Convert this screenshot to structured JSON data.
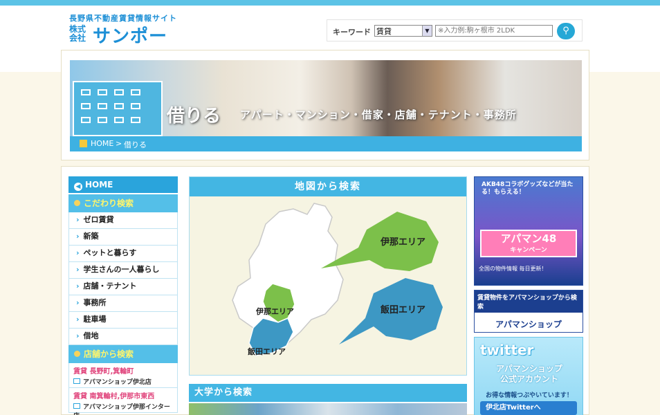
{
  "header": {
    "brand_sub": "長野県不動産賃貸情報サイト",
    "brand_co": "株式会社",
    "brand_name": "サンポー"
  },
  "search": {
    "label": "キーワード",
    "select_value": "賃貸",
    "placeholder": "※入力例:駒ヶ根市 2LDK",
    "button_icon": "search-icon"
  },
  "hero": {
    "title": "借りる",
    "subtitle": "アパート・マンション・借家・店舗・テナント・事務所"
  },
  "breadcrumb": {
    "home": "HOME",
    "separator": ">",
    "current": "借りる"
  },
  "sidebar": {
    "home": "HOME",
    "section1": "こだわり検索",
    "items": [
      "ゼロ賃貸",
      "新築",
      "ペットと暮らす",
      "学生さんの一人暮らし",
      "店舗・テナント",
      "事務所",
      "駐車場",
      "借地"
    ],
    "section2": "店舗から検索",
    "shops": [
      {
        "area": "賃貸 長野町,箕輪町",
        "name": "アパマンショップ伊北店"
      },
      {
        "area": "賃貸 南箕輪村,伊那市東西",
        "name": "アパマンショップ伊那インター店"
      }
    ]
  },
  "map": {
    "title": "地図から検索",
    "ina_label": "伊那エリア",
    "iida_label": "飯田エリア",
    "ina_bubble": "伊那エリア",
    "iida_bubble": "飯田エリア"
  },
  "university": {
    "title": "大学から検索"
  },
  "banners": {
    "akb_top": "AKB48コラボグッズなどが当たる！もらえる！",
    "akb_main": "アパマン48",
    "akb_campaign": "キャンペーン",
    "akb_foot": "全国の物件情報 毎日更新！",
    "apa_top": "賃貸物件をアパマンショップから検索",
    "apa_logo": "アパマンショップ",
    "tw_logo": "twitter",
    "tw_sub_1": "アパマンショップ",
    "tw_sub_2": "公式アカウント",
    "tw_msg": "お得な情報つぶやいています！",
    "tw_btn": "伊北店Twitterへ"
  },
  "colors": {
    "accent": "#43b6e3",
    "ina_green": "#7cc04a",
    "iida_blue": "#3d98c4"
  }
}
